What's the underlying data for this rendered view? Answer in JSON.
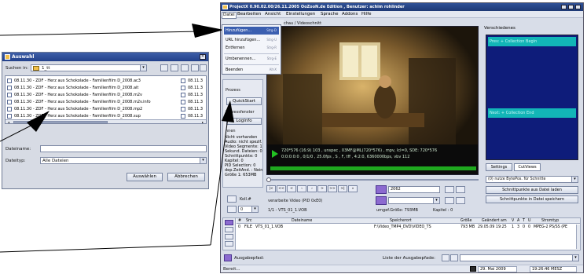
{
  "dialog": {
    "title": "Auswahl",
    "search_in_label": "Suchen in:",
    "search_in_value": "1_tt",
    "files_left": [
      "08.11.30 - ZDF - Herz aus Schokolade - Familienfilm D_2008.ac3",
      "08.11.30 - ZDF - Herz aus Schokolade - Familienfilm D_2008.ait",
      "08.11.30 - ZDF - Herz aus Schokolade - Familienfilm D_2008.m2v",
      "08.11.30 - ZDF - Herz aus Schokolade - Familienfilm D_2008.m2v.info",
      "08.11.30 - ZDF - Herz aus Schokolade - Familienfilm D_2008.mp2",
      "08.11.30 - ZDF - Herz aus Schokolade - Familienfilm D_2008.sup"
    ],
    "files_right": [
      "08.11.3",
      "08.11.3",
      "08.11.3",
      "08.11.3",
      "08.11.3",
      "08.11.3"
    ],
    "filename_label": "Dateiname:",
    "filename_value": "",
    "filetype_label": "Dateityp:",
    "filetype_value": "Alle Dateien",
    "open_button": "Auswählen",
    "cancel_button": "Abbrechen"
  },
  "window": {
    "title": "ProjectX 0.90.02.00/26.11.2005 OoZooN.de Edition , Benutzer: achim rohlinder",
    "menu": [
      "Datei",
      "Bearbeiten",
      "Ansicht",
      "Einstellungen",
      "Sprache",
      "Addons",
      "Hilfe"
    ],
    "dropdown": [
      {
        "label": "Hinzufügen...",
        "accel": "Strg-D"
      },
      {
        "label": "URL hinzufügen...",
        "accel": "Strg-U"
      },
      {
        "label": "Entfernen",
        "accel": "Strg-R"
      },
      {
        "label": "Umbenennen...",
        "accel": "Strg-E"
      },
      {
        "label": "Beenden",
        "accel": "Alt-X"
      }
    ],
    "preview_title": "chau / Videoschnitt",
    "video_info_line1": "720*576 (16:9) 103 , unspec , 03MF@ML(720*576) , mpv, lcl=0, SDE: 720*576",
    "video_info_line2": "0:0:0:0:0 , 0/1/0 , 25.0fps , S , F, tff , 4:2:0, 6360000bps, vbv 112",
    "left_panel_title": "Prozess",
    "quickstart_button": "QuickStart",
    "process_window_label": "Prozessfenster",
    "log_label": "Loginfo",
    "left_partial_label": "nnen",
    "left_info_lines": [
      "Nicht vorhanden",
      "Audio: nicht spezif.",
      "Video Segmente: 1",
      "Sekund. Dateien: 0",
      "Schnittpunkte: 0",
      "Kapitel: 0",
      "PID Selection: 0",
      "dep.ZeitAnd. : Nein",
      "Größe 1: 653MB"
    ],
    "right_title": "Verschiedenes",
    "collection_begin": "Prev: + Collection Begin",
    "collection_end": "Next: + Collection End",
    "tab_settings": "Settings",
    "tab_cutviews": "CutViews",
    "bytepos_label": "(0) nutze BytePos. für Schnitte",
    "load_cuts_button": "Schnittpunkte aus Datei laden",
    "save_cuts_button": "Schnittpunkte in Datei speichern",
    "cut_value": "2062",
    "kollid_label": "Koll.#",
    "kollid_value": "0",
    "process_video_label": "verarbeite Video (PID 0xE0)",
    "file_label": "1/1 - VTS_01_1.VOB",
    "size_label": "umgef.Größe: 793MB",
    "chapter_label": "Kapitel : 0",
    "table_headers": [
      "#",
      "Src",
      "Dateiname",
      "Speicherort",
      "Größe",
      "Geändert am",
      "V",
      "A",
      "T",
      "U",
      "Stromtyp"
    ],
    "table_row": [
      "0",
      "FILE",
      "VTS_01_1.VOB",
      "F:\\Video_TMP4_DVD\\VIDEO_TS",
      "793 MB",
      "29.05.09 19:25",
      "1",
      "3",
      "0",
      "0",
      "MPEG-2 PS/SS (PE"
    ],
    "output_label": "Ausgabepfad:",
    "output_list_label": "Liste der Ausgabepfade:",
    "status_left": "Bereit...",
    "status_date": "29. Mai 2009",
    "status_time": "19:26:46 MESZ"
  }
}
